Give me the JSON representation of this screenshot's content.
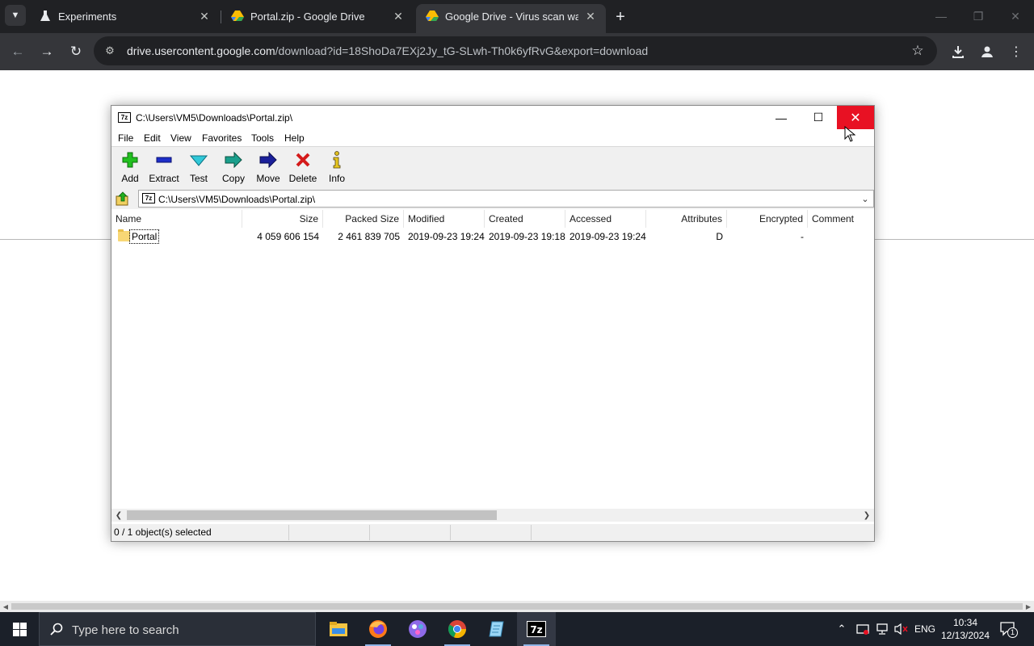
{
  "browser": {
    "tabs": [
      {
        "title": "Experiments",
        "icon": "flask-icon",
        "active": false
      },
      {
        "title": "Portal.zip - Google Drive",
        "icon": "google-drive-icon",
        "active": false
      },
      {
        "title": "Google Drive - Virus scan warn",
        "icon": "google-drive-icon",
        "active": true
      }
    ],
    "url_domain": "drive.usercontent.google.com",
    "url_path": "/download?id=18ShoDa7EXj2Jy_tG-SLwh-Th0k6yfRvG&export=download"
  },
  "sevenzip": {
    "title": "C:\\Users\\VM5\\Downloads\\Portal.zip\\",
    "menu": [
      "File",
      "Edit",
      "View",
      "Favorites",
      "Tools",
      "Help"
    ],
    "toolbar": [
      {
        "label": "Add",
        "icon": "add-icon"
      },
      {
        "label": "Extract",
        "icon": "extract-icon"
      },
      {
        "label": "Test",
        "icon": "test-icon"
      },
      {
        "label": "Copy",
        "icon": "copy-icon"
      },
      {
        "label": "Move",
        "icon": "move-icon"
      },
      {
        "label": "Delete",
        "icon": "delete-icon"
      },
      {
        "label": "Info",
        "icon": "info-icon"
      }
    ],
    "address": "C:\\Users\\VM5\\Downloads\\Portal.zip\\",
    "columns": [
      "Name",
      "Size",
      "Packed Size",
      "Modified",
      "Created",
      "Accessed",
      "Attributes",
      "Encrypted",
      "Comment"
    ],
    "rows": [
      {
        "name": "Portal",
        "size": "4 059 606 154",
        "packed": "2 461 839 705",
        "modified": "2019-09-23 19:24",
        "created": "2019-09-23 19:18",
        "accessed": "2019-09-23 19:24",
        "attributes": "D",
        "encrypted": "-",
        "comment": ""
      }
    ],
    "status": "0 / 1 object(s) selected",
    "close_color": "#e81123"
  },
  "taskbar": {
    "search_placeholder": "Type here to search",
    "apps": [
      "file-explorer-icon",
      "firefox-icon",
      "app-icon",
      "chrome-icon",
      "notepad-icon",
      "7zip-icon"
    ],
    "language": "ENG",
    "time": "10:34",
    "date": "12/13/2024",
    "notification_count": "1"
  }
}
